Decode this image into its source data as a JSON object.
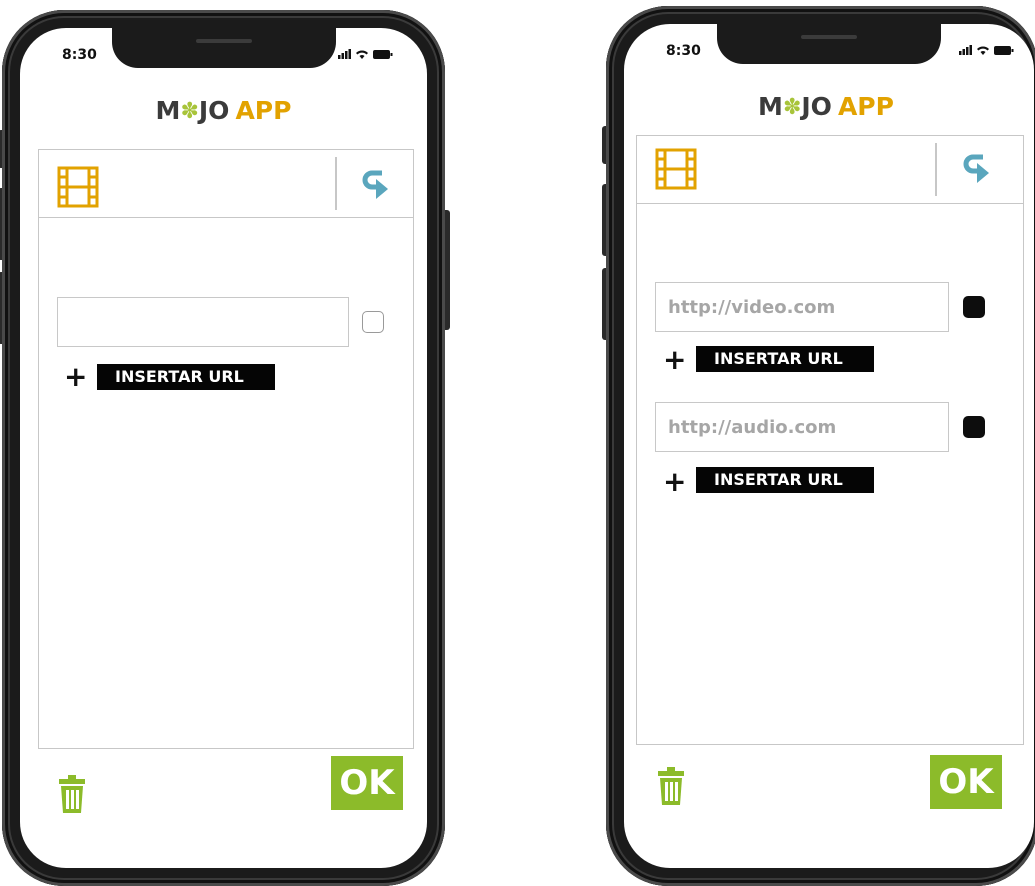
{
  "status": {
    "time": "8:30"
  },
  "logo": {
    "m": "M",
    "gear": "✽",
    "jo": "JO",
    "app": "APP"
  },
  "colors": {
    "accent_orange": "#e2a200",
    "accent_green": "#8cbb2a",
    "undo_blue": "#5aa6bd",
    "logo_gear": "#a8c43a"
  },
  "icons": {
    "header_left": "film-icon",
    "header_right": "undo-icon",
    "footer_left": "trash-icon"
  },
  "phone_left": {
    "inputs": [
      {
        "value": "",
        "checked": false,
        "insert_label": "INSERTAR URL"
      }
    ],
    "ok_label": "OK"
  },
  "phone_right": {
    "inputs": [
      {
        "value": "http://video.com",
        "checked": true,
        "insert_label": "INSERTAR URL"
      },
      {
        "value": "http://audio.com",
        "checked": true,
        "insert_label": "INSERTAR URL"
      }
    ],
    "ok_label": "OK"
  }
}
